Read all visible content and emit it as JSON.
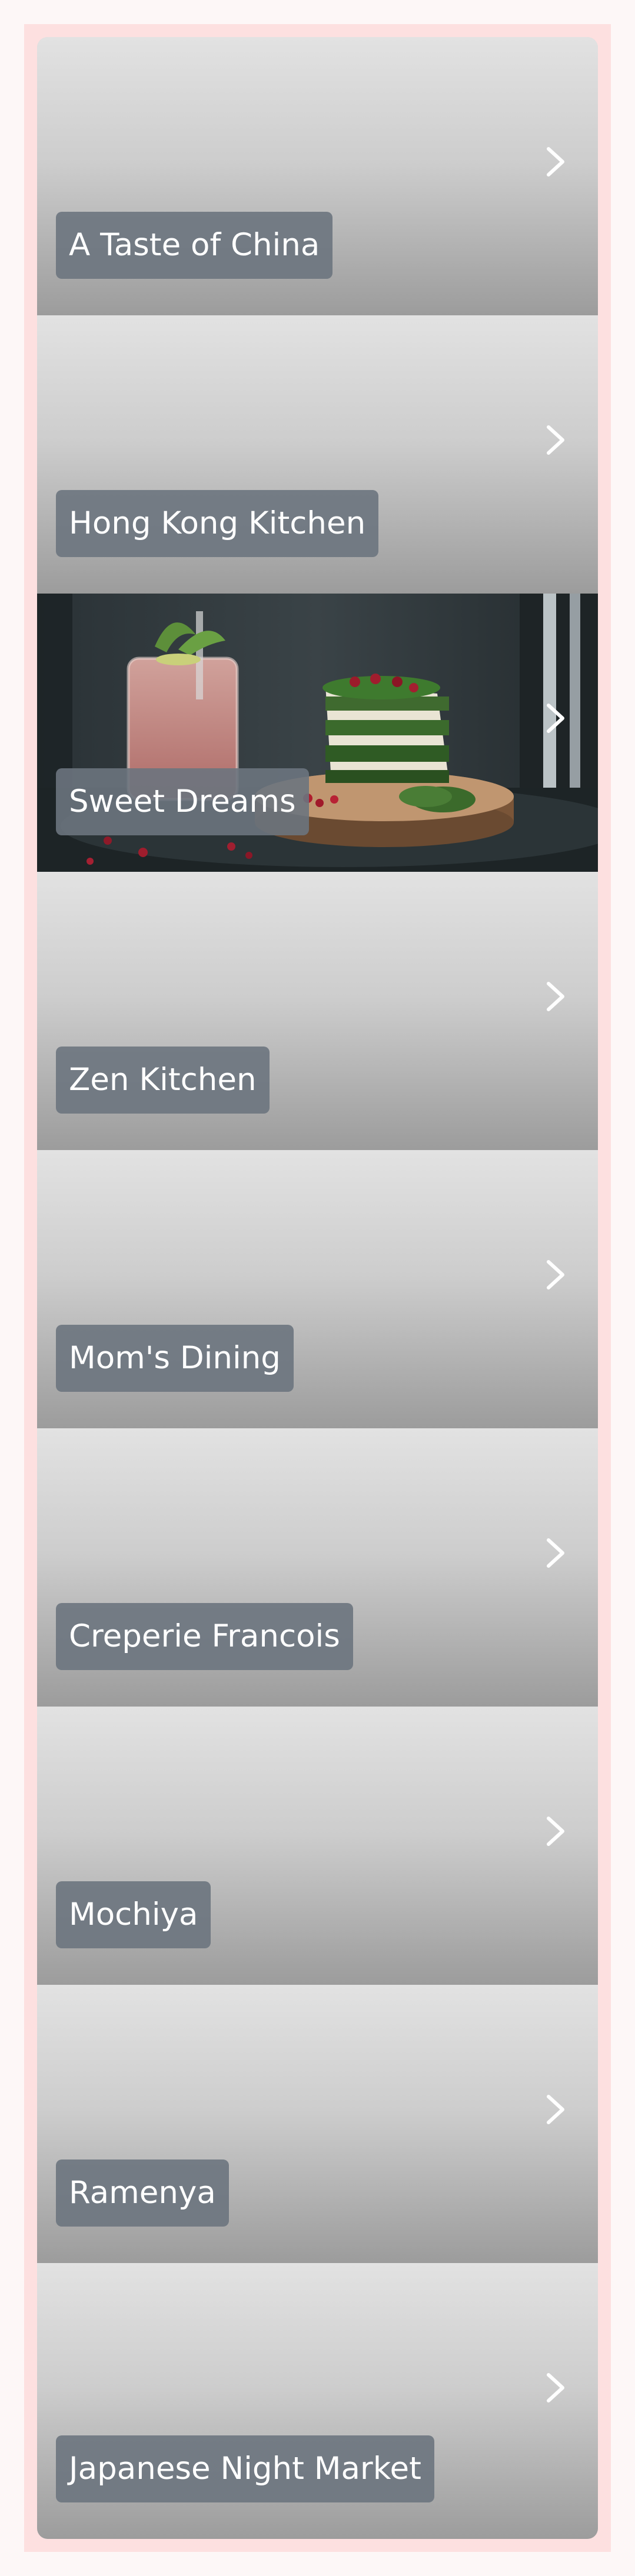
{
  "restaurants": [
    {
      "name": "A Taste of China",
      "has_photo": false
    },
    {
      "name": "Hong Kong Kitchen",
      "has_photo": false
    },
    {
      "name": "Sweet Dreams",
      "has_photo": true
    },
    {
      "name": "Zen Kitchen",
      "has_photo": false
    },
    {
      "name": "Mom's Dining",
      "has_photo": false
    },
    {
      "name": "Creperie Francois",
      "has_photo": false
    },
    {
      "name": "Mochiya",
      "has_photo": false
    },
    {
      "name": "Ramenya",
      "has_photo": false
    },
    {
      "name": "Japanese Night Market",
      "has_photo": false
    }
  ],
  "icons": {
    "chevron": "chevron-right-icon"
  },
  "colors": {
    "page_background": "#fdf7f7",
    "frame_background": "#fde0e0",
    "label_background": "#6c747e",
    "label_text": "#ffffff",
    "chevron": "#ffffff"
  }
}
